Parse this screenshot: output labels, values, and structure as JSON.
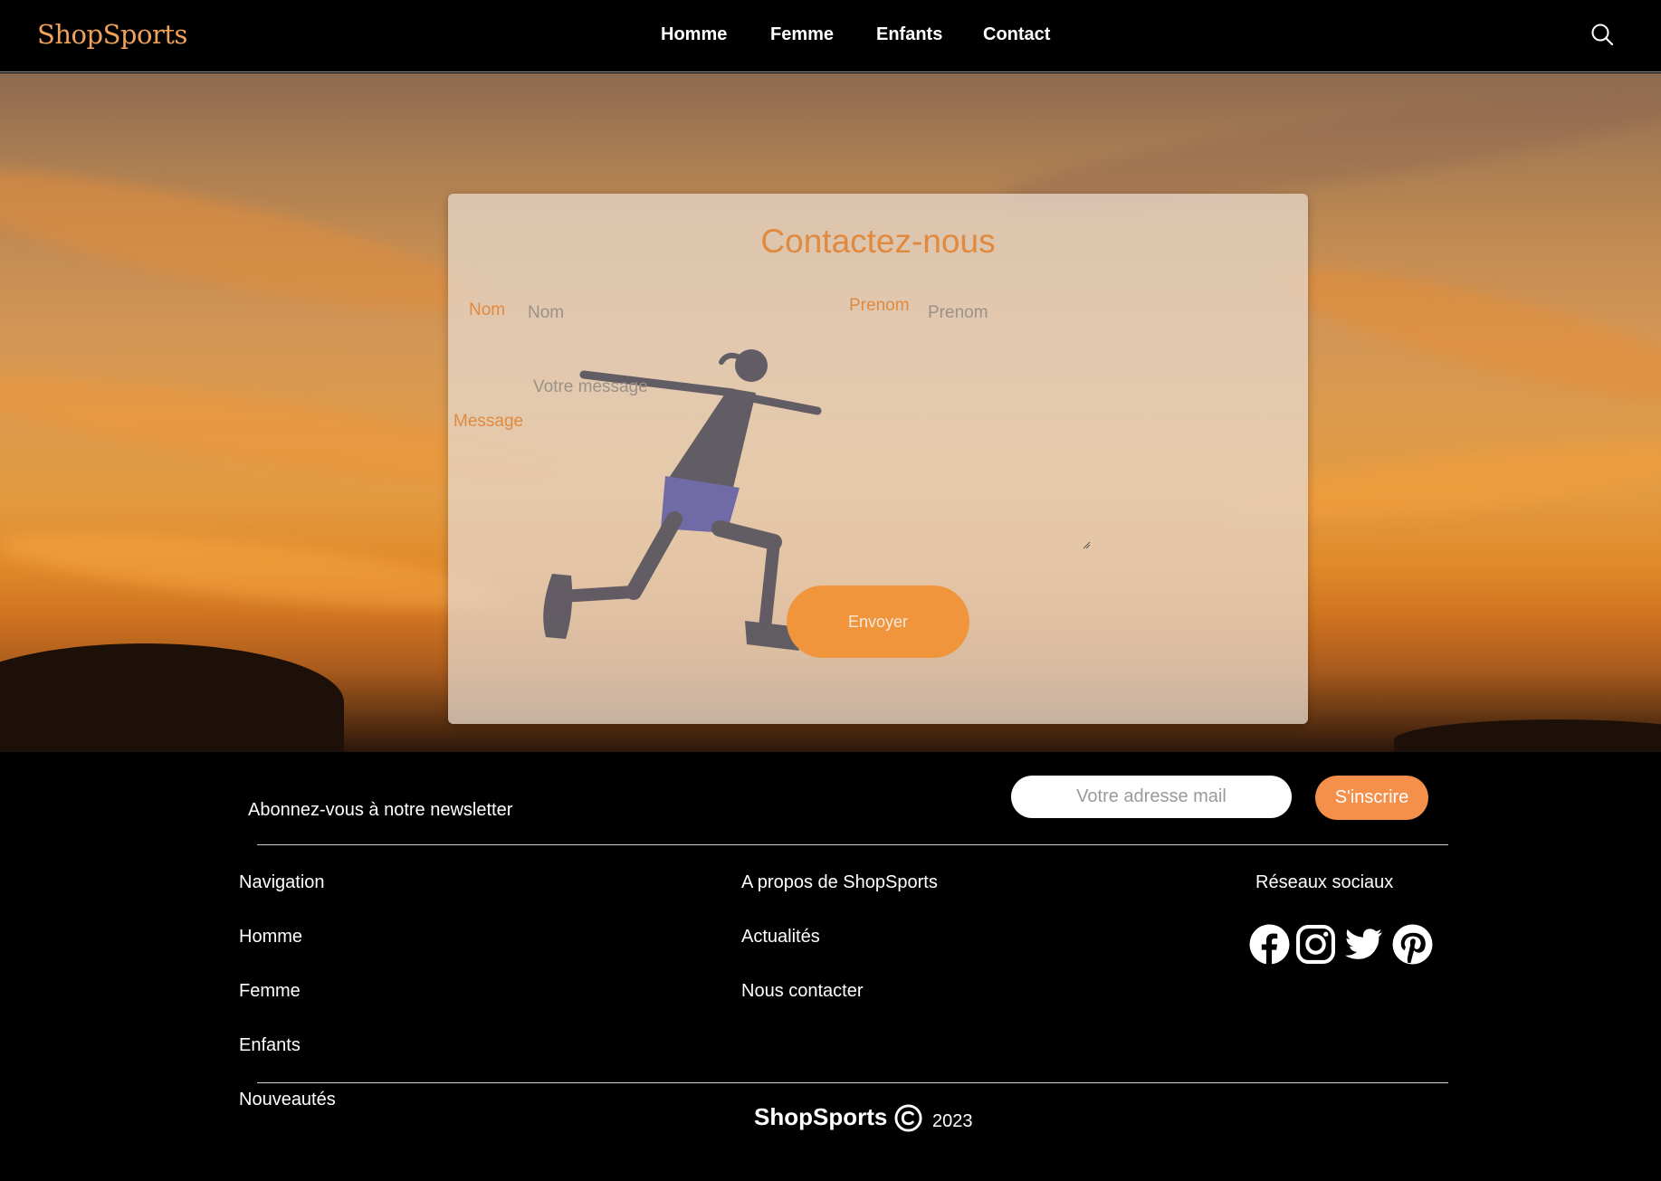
{
  "header": {
    "logo": "ShopSports",
    "nav": [
      "Homme",
      "Femme",
      "Enfants",
      "Contact"
    ],
    "search_icon": "search-icon"
  },
  "form": {
    "title": "Contactez-nous",
    "nom_label": "Nom",
    "nom_placeholder": "Nom",
    "prenom_label": "Prenom",
    "prenom_placeholder": "Prenom",
    "message_label": "Message",
    "message_placeholder": "Votre message",
    "submit_label": "Envoyer"
  },
  "footer": {
    "newsletter_text": "Abonnez-vous à notre newsletter",
    "email_placeholder": "Votre adresse mail",
    "subscribe_label": "S'inscrire",
    "navigation": {
      "heading": "Navigation",
      "links": [
        "Homme",
        "Femme",
        "Enfants",
        "Nouveautés"
      ]
    },
    "about": {
      "heading": "A propos de ShopSports",
      "links": [
        "Actualités",
        "Nous contacter"
      ]
    },
    "social": {
      "heading": "Réseaux sociaux",
      "icons": [
        "facebook-icon",
        "instagram-icon",
        "twitter-icon",
        "pinterest-icon"
      ]
    },
    "brand": "ShopSports",
    "copyright_icon": "copyright-icon",
    "year": "2023"
  },
  "colors": {
    "accent": "#f0953c",
    "title": "#e08a40",
    "background": "#000000"
  }
}
